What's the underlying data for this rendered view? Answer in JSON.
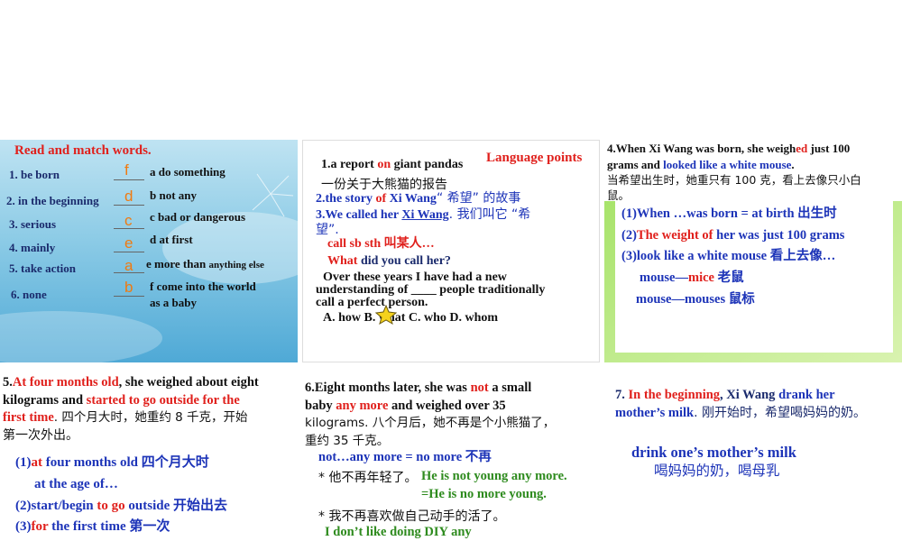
{
  "p1": {
    "title": "Read and match words.",
    "left": [
      "1. be born",
      "2. in the beginning",
      "3. serious",
      "4. mainly",
      "5. take action",
      "6. none"
    ],
    "answers": [
      "f",
      "d",
      "c",
      "e",
      "a",
      "b"
    ],
    "right": [
      "a  do something",
      "b  not any",
      "c  bad or dangerous",
      "d  at first",
      "e  more than ",
      "f  come into the world"
    ],
    "right_small": "anything else",
    "right_extra": "as a baby"
  },
  "p2": {
    "heading": "Language points",
    "l1a": "1.a report ",
    "l1b": "on",
    "l1c": " giant pandas",
    "l1cn": "一份关于大熊猫的报告",
    "l2a": "2.the story ",
    "l2b": "of",
    "l2c": " Xi Wang",
    "l2d": "“ 希望” 的故事",
    "l3a": "3.We called her ",
    "l3b": "Xi Wang",
    "l3c": ". 我们叫它  “希",
    "l3d": "望”.",
    "l4": "call sb sth  叫某人…",
    "l5a": "What",
    "l5b": " did you call her?",
    "l6": "Over these years I have had a new",
    "l7": "understanding of ____ people traditionally",
    "l8": "call a perfect person.",
    "opts": "A. how    B. what    C. who    D. whom"
  },
  "p3": {
    "l1a": "4.When Xi Wang was born, she weigh",
    "l1b": "ed",
    "l1c": "  just 100",
    "l2a": "grams and ",
    "l2b": "looked like a white mouse",
    "l2c": ".",
    "l3": "当希望出生时，她重只有 100 克，看上去像只小白",
    "l4": "鼠。",
    "b1": "(1)When …was born = at birth  出生时",
    "b2a": "(2)",
    "b2b": "The weight of",
    "b2c": " her was just 100 grams",
    "b3": "(3)look like a white mouse  看上去像…",
    "b4a": "mouse—",
    "b4b": "mice",
    "b4c": "  老鼠",
    "b5": "mouse—mouses  鼠标"
  },
  "p4": {
    "l1a": "5.",
    "l1b": "At four months old",
    "l1c": ", she weighed about eight",
    "l2a": "kilograms and ",
    "l2b": "started to go outside for the",
    "l3a": "first time",
    "l3b": ". 四个月大时，她重约 8 千克，开始",
    "l4": "第一次外出。",
    "b1a": "(1)",
    "b1b": "at",
    "b1c": " four months old  四个月大时",
    "b2": "at the age of…",
    "b3a": "(2)start/begin ",
    "b3b": "to go",
    "b3c": " outside  开始出去",
    "b4a": "(3)",
    "b4b": "for",
    "b4c": " the first time  第一次"
  },
  "p5": {
    "l1a": "6.Eight months later, she was ",
    "l1b": "not",
    "l1c": " a small",
    "l2a": "baby ",
    "l2b": "any more",
    "l2c": " and weighed over 35",
    "l3": "kilograms. 八个月后，她不再是个小熊猫了，",
    "l4": "重约 35 千克。",
    "l5": "not…any more = no more  不再",
    "l6": "* 他不再年轻了。",
    "l6b": "He is not young any more.",
    "l7": "=He is no more young.",
    "l8": "* 我不再喜欢做自己动手的活了。",
    "l9": "I don’t like doing DIY any"
  },
  "p6": {
    "l1a": "7. ",
    "l1b": "In the beginning",
    "l1c": ", Xi Wang ",
    "l1d": "drank her",
    "l2a": "mother’s milk",
    "l2b": ". 刚开始时，希望喝妈妈的奶。",
    "l3": "drink one’s mother’s milk",
    "l4": "喝妈妈的奶，喝母乳"
  }
}
